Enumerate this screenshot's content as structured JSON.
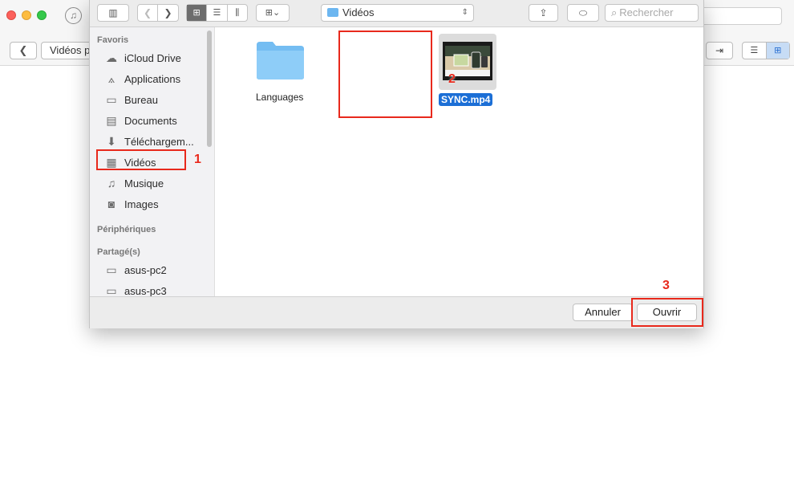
{
  "app": {
    "breadcrumb": "Vidéos p",
    "back_glyph": "❮",
    "export_glyph": "⇥",
    "view_list_glyph": "☰",
    "view_grid_glyph": "⊞",
    "itunes_glyph": "♫"
  },
  "dialog": {
    "toolbar": {
      "sidebar_glyph": "▥",
      "back_glyph": "❮",
      "forward_glyph": "❯",
      "view_icons_glyph": "⊞",
      "view_list_glyph": "☰",
      "view_columns_glyph": "⫼",
      "arrange_glyph": "⊞⌄",
      "location": "Vidéos",
      "location_arrows": "⇕",
      "share_glyph": "⇪",
      "tag_glyph": "⬭",
      "search_placeholder": "Rechercher",
      "search_glyph": "⌕"
    },
    "sidebar": {
      "favorites_header": "Favoris",
      "favorites": [
        {
          "label": "iCloud Drive",
          "icon": "cloud-icon",
          "glyph": "☁"
        },
        {
          "label": "Applications",
          "icon": "applications-icon",
          "glyph": "⟑"
        },
        {
          "label": "Bureau",
          "icon": "desktop-icon",
          "glyph": "▭"
        },
        {
          "label": "Documents",
          "icon": "documents-icon",
          "glyph": "▤"
        },
        {
          "label": "Téléchargem...",
          "icon": "download-icon",
          "glyph": "⬇"
        },
        {
          "label": "Vidéos",
          "icon": "film-icon",
          "glyph": "▦"
        },
        {
          "label": "Musique",
          "icon": "music-icon",
          "glyph": "♫"
        },
        {
          "label": "Images",
          "icon": "camera-icon",
          "glyph": "◙"
        }
      ],
      "devices_header": "Périphériques",
      "shared_header": "Partagé(s)",
      "shared": [
        {
          "label": "asus-pc2",
          "icon": "computer-icon",
          "glyph": "▭"
        },
        {
          "label": "asus-pc3",
          "icon": "computer-icon",
          "glyph": "▭"
        }
      ]
    },
    "files": [
      {
        "name": "Languages",
        "kind": "folder"
      },
      {
        "name": "SYNC.mp4",
        "kind": "video",
        "selected": true
      }
    ],
    "footer": {
      "cancel_label": "Annuler",
      "open_label": "Ouvrir"
    }
  },
  "annotations": [
    {
      "number": "1"
    },
    {
      "number": "2"
    },
    {
      "number": "3"
    }
  ],
  "colors": {
    "selection": "#1c6fd6",
    "annotation_red": "#e8291c",
    "folder_blue": "#6cb6f0"
  }
}
